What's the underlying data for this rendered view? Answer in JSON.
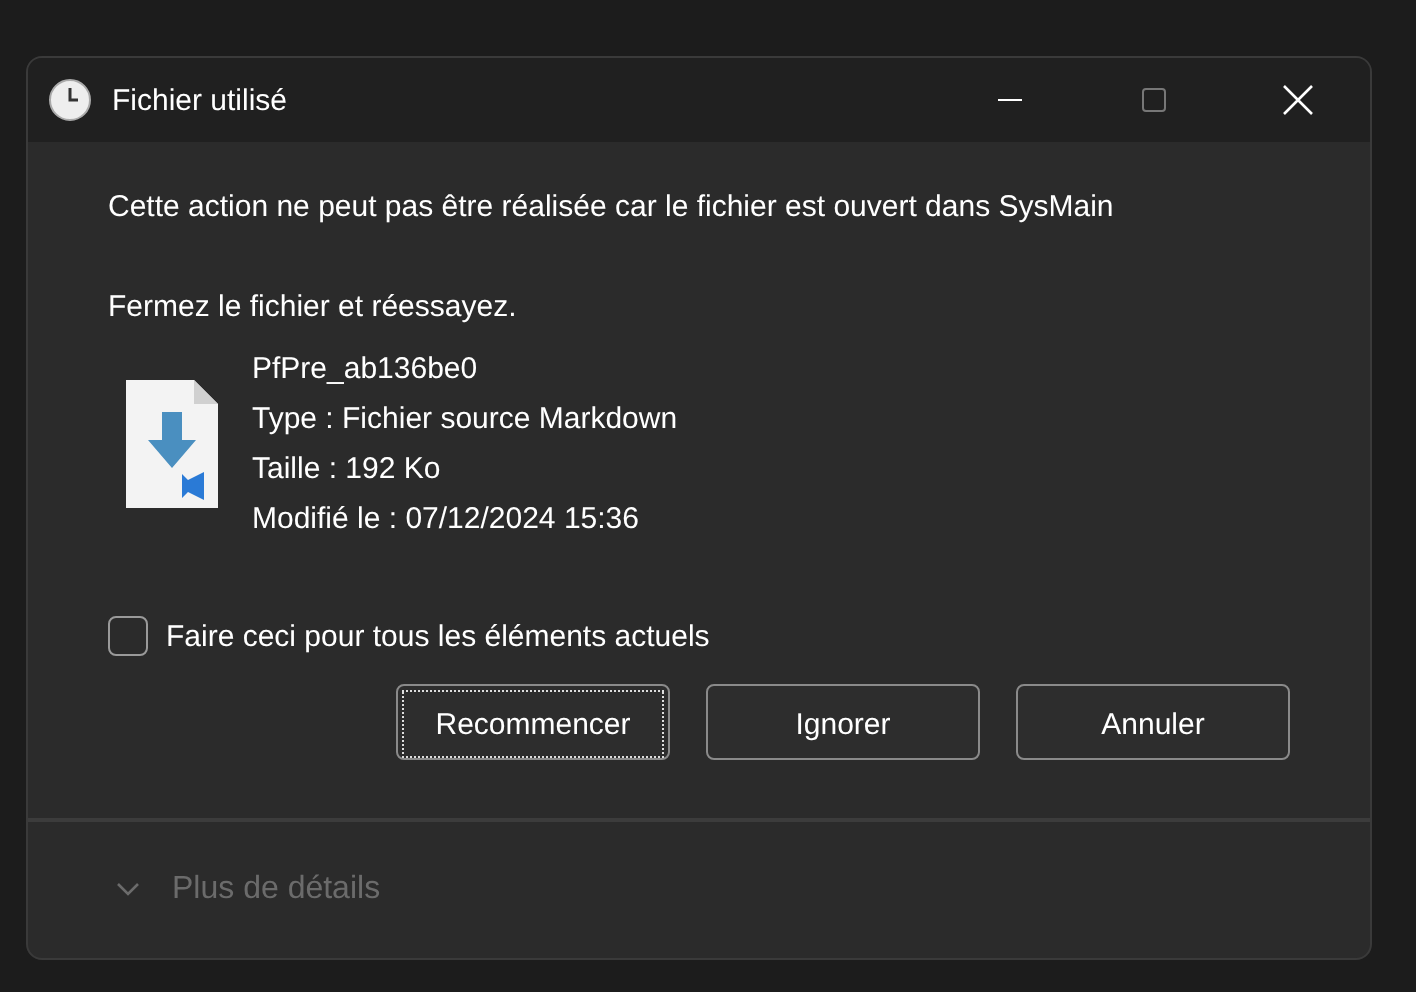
{
  "window": {
    "title": "Fichier utilisé"
  },
  "message": "Cette action ne peut pas être réalisée car le fichier est ouvert dans SysMain",
  "instruction": "Fermez le fichier et réessayez.",
  "file": {
    "name": "PfPre_ab136be0",
    "details": [
      "Type : Fichier source Markdown",
      "Taille : 192 Ko",
      "Modifié le : 07/12/2024 15:36"
    ]
  },
  "apply_all": {
    "label": "Faire ceci pour tous les éléments actuels",
    "checked": false
  },
  "buttons": [
    {
      "label": "Recommencer",
      "focused": true
    },
    {
      "label": "Ignorer",
      "focused": false
    },
    {
      "label": "Annuler",
      "focused": false
    }
  ],
  "details_toggle": {
    "label": "Plus de détails",
    "disabled": true
  }
}
